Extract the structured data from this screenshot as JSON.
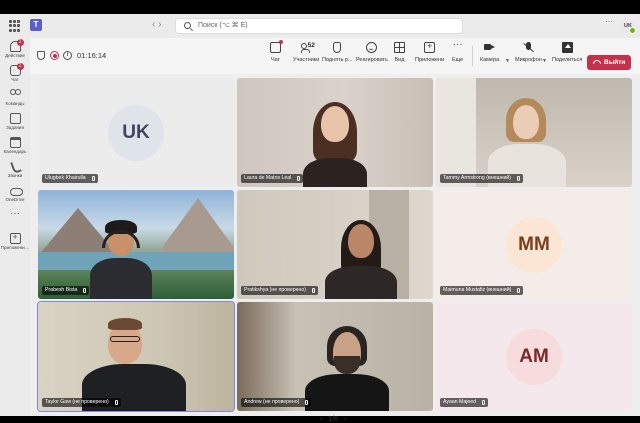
{
  "titlebar": {
    "search_placeholder": "Поиск (⌥ ⌘ E)",
    "more": "···",
    "me_initials": "UK"
  },
  "rail": {
    "items": [
      {
        "label": "Действие",
        "icon": "bell-icon",
        "badge": "1"
      },
      {
        "label": "Чат",
        "icon": "chat-icon",
        "badge": "1"
      },
      {
        "label": "Команды",
        "icon": "teams-icon"
      },
      {
        "label": "Задания",
        "icon": "assignments-icon"
      },
      {
        "label": "Календарь",
        "icon": "calendar-icon"
      },
      {
        "label": "Звонки",
        "icon": "calls-icon"
      },
      {
        "label": "OneDrive",
        "icon": "onedrive-icon"
      },
      {
        "label": "",
        "icon": "more-icon"
      },
      {
        "label": "Приложени…",
        "icon": "apps-icon"
      }
    ]
  },
  "meeting": {
    "timer": "01:16:14",
    "participants_count": "52",
    "buttons": {
      "chat": "Чат",
      "people": "Участники",
      "raise": "Поднять р...",
      "react": "Реагировать",
      "view": "Вид",
      "apps": "Приложени",
      "more": "Еще",
      "camera": "Камера",
      "mic": "Микрофон",
      "share": "Поделиться",
      "leave": "Выйти"
    }
  },
  "tiles": [
    {
      "name": "Ulugbek Khairulla",
      "initials": "UK",
      "type": "avatar",
      "bg": "#ececec",
      "circle": "#dfe3ea",
      "fg": "#3f4660"
    },
    {
      "name": "Laura de Matos Leal",
      "type": "video"
    },
    {
      "name": "Tammy Armstrong (внешний)",
      "type": "video"
    },
    {
      "name": "Prabesh Bista",
      "type": "video"
    },
    {
      "name": "Pratikshya (не проверено)",
      "type": "video"
    },
    {
      "name": "Maimuna Mustafiz (внешний)",
      "initials": "MM",
      "type": "avatar",
      "bg": "#f3ece8",
      "circle": "#fbe6d6",
      "fg": "#7a3e1a"
    },
    {
      "name": "Taylor Gaw (не проверено)",
      "type": "video"
    },
    {
      "name": "Andrew (не проверено)",
      "type": "video"
    },
    {
      "name": "Ayaan Majeed",
      "initials": "AM",
      "type": "avatar",
      "bg": "#f4e8ec",
      "circle": "#f6dcdc",
      "fg": "#7a2a2a"
    }
  ],
  "pager": {
    "prev": "‹",
    "label": "1/6",
    "next": "›"
  }
}
